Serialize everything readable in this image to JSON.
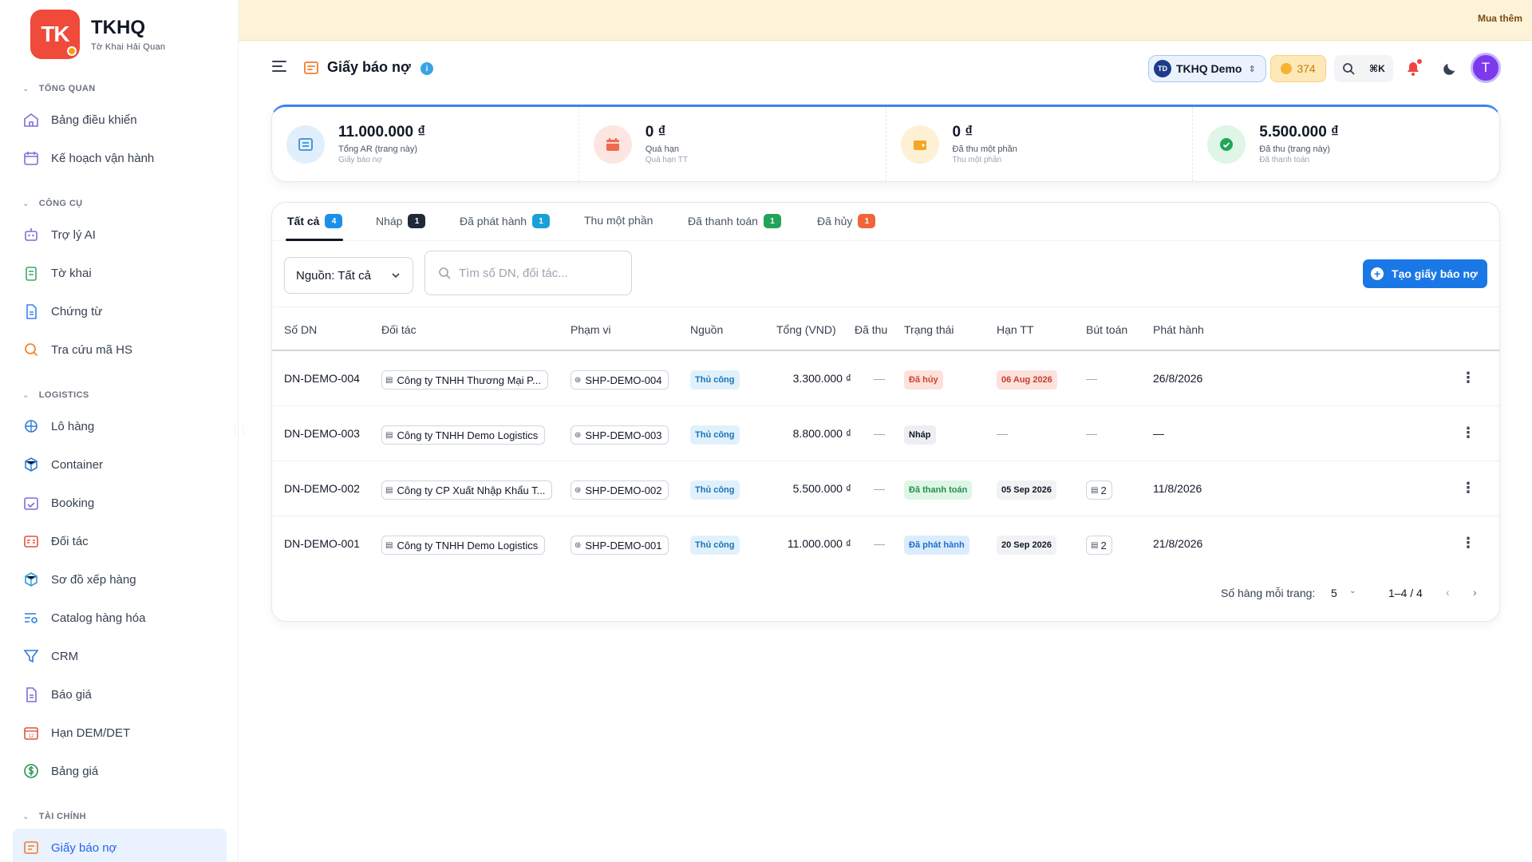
{
  "brand": {
    "logo": "TK",
    "title": "TKHQ",
    "subtitle": "Tờ Khai Hải Quan"
  },
  "banner": {
    "button": "Mua thêm"
  },
  "sidebar": {
    "sections": [
      {
        "label": "TỔNG QUAN",
        "items": [
          {
            "label": "Bảng điều khiển",
            "icon": "home-icon"
          },
          {
            "label": "Kế hoạch vận hành",
            "icon": "calendar-icon"
          }
        ]
      },
      {
        "label": "CÔNG CỤ",
        "items": [
          {
            "label": "Trợ lý AI",
            "icon": "robot-icon"
          },
          {
            "label": "Tờ khai",
            "icon": "clipboard-icon"
          },
          {
            "label": "Chứng từ",
            "icon": "file-icon"
          },
          {
            "label": "Tra cứu mã HS",
            "icon": "search-icon"
          }
        ]
      },
      {
        "label": "LOGISTICS",
        "items": [
          {
            "label": "Lô hàng",
            "icon": "ship-icon"
          },
          {
            "label": "Container",
            "icon": "box-icon"
          },
          {
            "label": "Booking",
            "icon": "calendar-check-icon"
          },
          {
            "label": "Đối tác",
            "icon": "id-card-icon"
          },
          {
            "label": "Sơ đồ xếp hàng",
            "icon": "cube-icon"
          },
          {
            "label": "Catalog hàng hóa",
            "icon": "list-search-icon"
          },
          {
            "label": "CRM",
            "icon": "funnel-icon"
          },
          {
            "label": "Báo giá",
            "icon": "document-icon"
          },
          {
            "label": "Hạn DEM/DET",
            "icon": "calendar-12-icon"
          },
          {
            "label": "Bảng giá",
            "icon": "dollar-icon"
          }
        ]
      },
      {
        "label": "TÀI CHÍNH",
        "items": [
          {
            "label": "Giấy báo nợ",
            "icon": "receipt-icon",
            "active": true
          }
        ]
      }
    ]
  },
  "header": {
    "title": "Giấy báo nợ",
    "org_initials": "TD",
    "org_name": "TKHQ Demo",
    "coins": "374",
    "shortcut": "⌘K",
    "user_initial": "T"
  },
  "stats": [
    {
      "value": "11.000.000 ₫",
      "label": "Tổng AR (trang này)",
      "sub": "Giấy báo nợ"
    },
    {
      "value": "0 ₫",
      "label": "Quá hạn",
      "sub": "Quá hạn TT"
    },
    {
      "value": "0 ₫",
      "label": "Đã thu một phần",
      "sub": "Thu một phần"
    },
    {
      "value": "5.500.000 ₫",
      "label": "Đã thu (trang này)",
      "sub": "Đã thanh toán"
    }
  ],
  "tabs": [
    {
      "label": "Tất cả",
      "count": "4"
    },
    {
      "label": "Nháp",
      "count": "1"
    },
    {
      "label": "Đã phát hành",
      "count": "1"
    },
    {
      "label": "Thu một phần",
      "count": ""
    },
    {
      "label": "Đã thanh toán",
      "count": "1"
    },
    {
      "label": "Đã hủy",
      "count": "1"
    }
  ],
  "filter": {
    "source_label": "Nguồn: Tất cả",
    "search_placeholder": "Tìm số DN, đối tác..."
  },
  "create_button": "Tạo giấy báo nợ",
  "table": {
    "columns": [
      "Số DN",
      "Đối tác",
      "Phạm vi",
      "Nguồn",
      "Tổng (VND)",
      "Đã thu",
      "Trạng thái",
      "Hạn TT",
      "Bút toán",
      "Phát hành"
    ],
    "rows": [
      {
        "no": "DN-DEMO-004",
        "partner": "Công ty TNHH Thương Mại P...",
        "scope": "SHP-DEMO-004",
        "source": "Thủ công",
        "total": "3.300.000 ₫",
        "paid": "—",
        "status": "Đã hủy",
        "status_type": "cancel",
        "due": "06 Aug 2026",
        "due_type": "red",
        "entries": "",
        "issued": "26/8/2026"
      },
      {
        "no": "DN-DEMO-003",
        "partner": "Công ty TNHH Demo Logistics",
        "scope": "SHP-DEMO-003",
        "source": "Thủ công",
        "total": "8.800.000 ₫",
        "paid": "—",
        "status": "Nháp",
        "status_type": "draft",
        "due": "",
        "due_type": "none",
        "entries": "",
        "issued": "—"
      },
      {
        "no": "DN-DEMO-002",
        "partner": "Công ty CP Xuất Nhập Khẩu T...",
        "scope": "SHP-DEMO-002",
        "source": "Thủ công",
        "total": "5.500.000 ₫",
        "paid": "—",
        "status": "Đã thanh toán",
        "status_type": "paid",
        "due": "05 Sep 2026",
        "due_type": "normal",
        "entries": "2",
        "issued": "11/8/2026"
      },
      {
        "no": "DN-DEMO-001",
        "partner": "Công ty TNHH Demo Logistics",
        "scope": "SHP-DEMO-001",
        "source": "Thủ công",
        "total": "11.000.000 ₫",
        "paid": "—",
        "status": "Đã phát hành",
        "status_type": "issued",
        "due": "20 Sep 2026",
        "due_type": "normal",
        "entries": "2",
        "issued": "21/8/2026"
      }
    ]
  },
  "pager": {
    "label": "Số hàng mỗi trang:",
    "rows": "5",
    "range": "1–4 / 4"
  }
}
